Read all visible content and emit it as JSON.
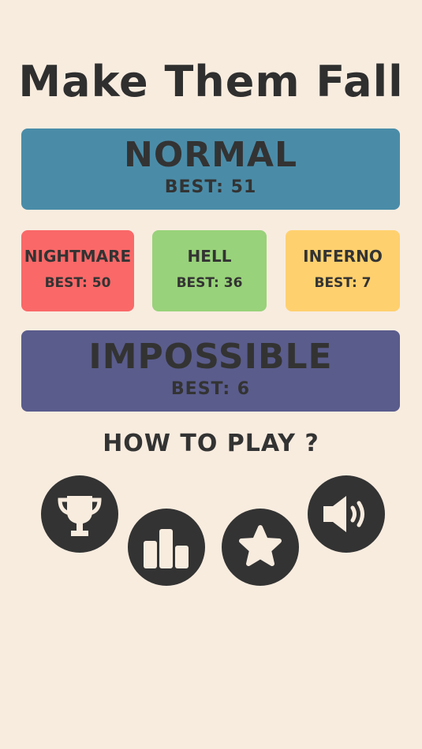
{
  "title": "Make Them Fall",
  "modes": {
    "normal": {
      "name": "NORMAL",
      "best": "BEST:  51",
      "color": "#4a8ca8"
    },
    "nightmare": {
      "name": "NIGHTMARE",
      "best": "BEST:  50",
      "color": "#fa6868"
    },
    "hell": {
      "name": "HELL",
      "best": "BEST:  36",
      "color": "#98d27a"
    },
    "inferno": {
      "name": "INFERNO",
      "best": "BEST:  7",
      "color": "#ffd06e"
    },
    "impossible": {
      "name": "IMPOSSIBLE",
      "best": "BEST:  6",
      "color": "#5a5c8c"
    }
  },
  "how_to_play": "HOW TO PLAY ?",
  "icon_buttons": [
    {
      "icon": "trophy-icon"
    },
    {
      "icon": "leaderboard-icon"
    },
    {
      "icon": "star-icon"
    },
    {
      "icon": "speaker-icon"
    }
  ],
  "colors": {
    "background": "#f8ecdf",
    "text": "#2f2f2f",
    "button": "#333333",
    "icon": "#f8ecdf"
  }
}
